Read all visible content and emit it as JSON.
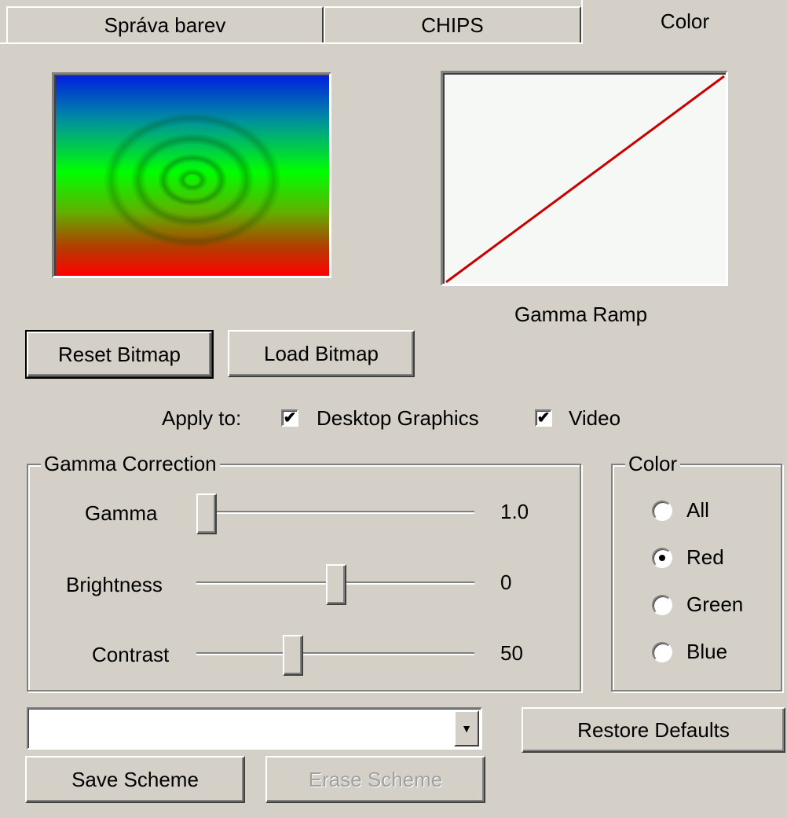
{
  "tabs": [
    {
      "label": "Správa barev"
    },
    {
      "label": "CHIPS"
    },
    {
      "label": "Color"
    }
  ],
  "gamma_ramp": {
    "label": "Gamma Ramp"
  },
  "buttons": {
    "reset_bitmap": "Reset Bitmap",
    "load_bitmap": "Load Bitmap",
    "restore_defaults": "Restore Defaults",
    "save_scheme": "Save Scheme",
    "erase_scheme": "Erase Scheme"
  },
  "apply_to": {
    "label": "Apply to:",
    "desktop_graphics": {
      "label": "Desktop Graphics",
      "checked": true
    },
    "video": {
      "label": "Video",
      "checked": true
    }
  },
  "gamma_correction": {
    "title": "Gamma Correction",
    "gamma": {
      "label": "Gamma",
      "value": "1.0"
    },
    "brightness": {
      "label": "Brightness",
      "value": "0"
    },
    "contrast": {
      "label": "Contrast",
      "value": "50"
    }
  },
  "color_group": {
    "title": "Color",
    "options": [
      {
        "label": "All",
        "selected": false
      },
      {
        "label": "Red",
        "selected": true
      },
      {
        "label": "Green",
        "selected": false
      },
      {
        "label": "Blue",
        "selected": false
      }
    ]
  },
  "scheme_combo": {
    "value": ""
  },
  "check_mark": "✔",
  "combo_arrow": "▼"
}
